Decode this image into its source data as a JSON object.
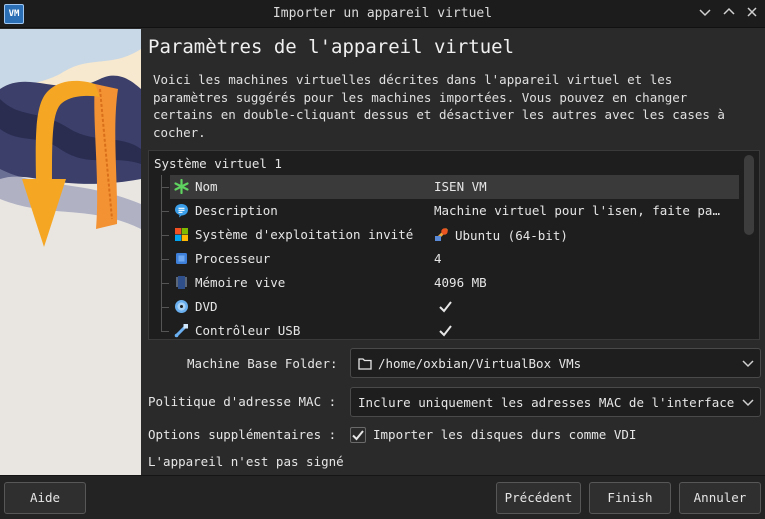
{
  "window": {
    "title": "Importer un appareil virtuel",
    "app_icon_text": "VM"
  },
  "heading": "Paramètres de l'appareil virtuel",
  "intro": "Voici les machines virtuelles décrites dans l'appareil virtuel et les paramètres suggérés pour les machines importées. Vous pouvez en changer certains en double-cliquant dessus et désactiver les autres avec les cases à cocher.",
  "tree": {
    "root": "Système virtuel 1",
    "rows": [
      {
        "label": "Nom",
        "value": "ISEN VM",
        "icon": "name-icon",
        "selected": true
      },
      {
        "label": "Description",
        "value": "Machine virtuel pour l'isen, faite pa…",
        "icon": "description-icon"
      },
      {
        "label": "Système d'exploitation invité",
        "value": "Ubuntu (64-bit)",
        "icon": "os-icon"
      },
      {
        "label": "Processeur",
        "value": "4",
        "icon": "cpu-icon"
      },
      {
        "label": "Mémoire vive",
        "value": "4096 MB",
        "icon": "ram-icon"
      },
      {
        "label": "DVD",
        "checked": true,
        "icon": "dvd-icon"
      },
      {
        "label": "Contrôleur USB",
        "checked": true,
        "icon": "usb-icon"
      }
    ]
  },
  "base_folder": {
    "label": "Machine Base Folder:",
    "value": "/home/oxbian/VirtualBox VMs"
  },
  "mac_policy": {
    "label": "Politique d'adresse MAC :",
    "value": "Inclure uniquement les adresses MAC de l'interface"
  },
  "options": {
    "label": "Options supplémentaires :",
    "checkbox_label": "Importer les disques durs comme VDI",
    "checked": true
  },
  "signature_status": "L'appareil n'est pas signé",
  "buttons": {
    "help": "Aide",
    "back": "Précédent",
    "finish": "Finish",
    "cancel": "Annuler"
  },
  "colors": {
    "window_bg": "#2a2a2a",
    "field_bg": "#1e1e1e",
    "selection": "#3a3a3a",
    "banner_arrow": "#f5a623"
  }
}
